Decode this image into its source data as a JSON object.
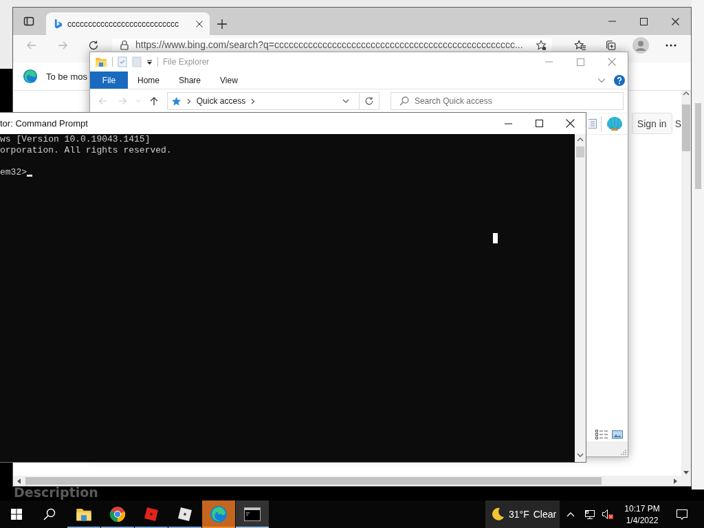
{
  "background": {
    "caption": "Description"
  },
  "browser": {
    "tab_title": "ccccccccccccccccccccccccccc",
    "url": "https://www.bing.com/search?q=cccccccccccccccccccccccccccccccccccccccccccccccccc...",
    "infobar_text": "To be mos",
    "sign_in": "Sign in",
    "cut_text": "S"
  },
  "file_explorer": {
    "title": "File Explorer",
    "ribbon_tabs": [
      {
        "label": "File",
        "kind": "menu"
      },
      {
        "label": "Home",
        "kind": "tab"
      },
      {
        "label": "Share",
        "kind": "tab"
      },
      {
        "label": "View",
        "kind": "tab"
      }
    ],
    "breadcrumb": "Quick access",
    "search": {
      "placeholder": "Search Quick access"
    }
  },
  "command_prompt": {
    "title": "tor: Command Prompt",
    "lines": [
      "ws [Version 10.0.19043.1415]",
      "orporation. All rights reserved."
    ],
    "prompt": "em32>"
  },
  "taskbar": {
    "apps": [
      {
        "kind": "file-explorer",
        "selected": false,
        "flashing": false
      },
      {
        "kind": "chrome",
        "selected": false,
        "flashing": false
      },
      {
        "kind": "game-red",
        "selected": false,
        "flashing": false
      },
      {
        "kind": "game-white",
        "selected": false,
        "flashing": false
      },
      {
        "kind": "edge",
        "selected": false,
        "flashing": true
      },
      {
        "kind": "terminal",
        "selected": true,
        "flashing": false
      }
    ],
    "weather": {
      "temperature": "31°F",
      "condition": "Clear"
    },
    "clock": {
      "time": "10:17 PM",
      "date": "1/4/2022"
    }
  }
}
